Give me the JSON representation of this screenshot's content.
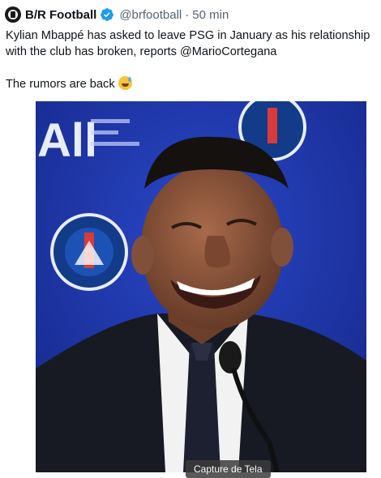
{
  "tweet": {
    "author": "B/R Football",
    "handle": "@brfootball",
    "separator": "·",
    "time": "50 min",
    "text_line1": "Kylian Mbappé has asked to leave PSG in January as his relationship with the club has broken, reports @MarioCortegana",
    "text_line2": "The rumors are back",
    "emoji": "grinning-face-with-sweat"
  },
  "media": {
    "alt": "Kylian Mbappé laughing at a PSG press conference",
    "backdrop_text": "All",
    "tooltip": "Capture de Tela"
  },
  "colors": {
    "verified": "#1d9bf0",
    "secondary_text": "#536471",
    "backdrop_blue": "#1b35a8"
  }
}
